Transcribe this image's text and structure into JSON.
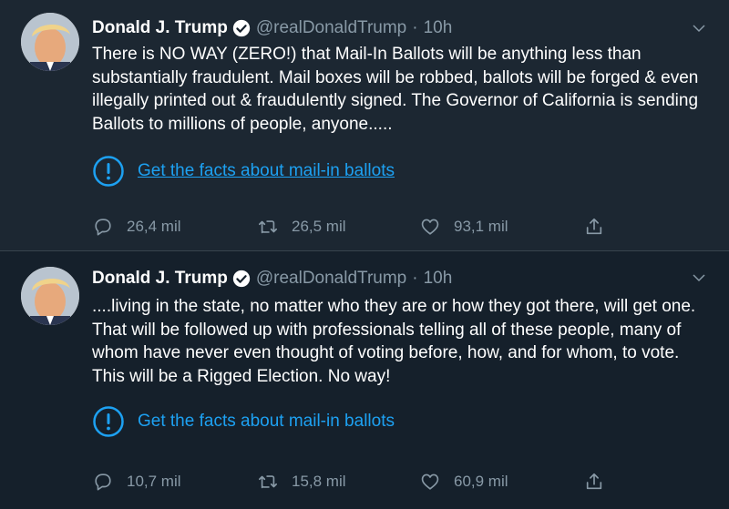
{
  "tweets": [
    {
      "author": "Donald J. Trump",
      "handle": "@realDonaldTrump",
      "separator": "·",
      "time": "10h",
      "text": "There is NO WAY (ZERO!) that Mail-In Ballots will be anything less than substantially fraudulent. Mail boxes will be robbed, ballots will be forged & even illegally printed out & fraudulently signed. The Governor of California is sending Ballots to millions of people, anyone.....",
      "facts_label": "Get the facts about mail-in ballots",
      "replies": "26,4 mil",
      "retweets": "26,5 mil",
      "likes": "93,1 mil"
    },
    {
      "author": "Donald J. Trump",
      "handle": "@realDonaldTrump",
      "separator": "·",
      "time": "10h",
      "text": "....living in the state, no matter who they are or how they got there, will get one. That will be followed up with professionals telling all of these people, many of whom have never even thought of voting before, how, and for whom, to vote. This will be a Rigged Election. No way!",
      "facts_label": "Get the facts about mail-in ballots",
      "replies": "10,7 mil",
      "retweets": "15,8 mil",
      "likes": "60,9 mil"
    }
  ],
  "icons": {
    "verified": "verified-badge-icon",
    "caret": "chevron-down-icon",
    "facts": "exclamation-circle-icon",
    "reply": "reply-icon",
    "retweet": "retweet-icon",
    "like": "heart-icon",
    "share": "share-icon"
  },
  "colors": {
    "background": "#15202b",
    "highlighted_background": "#1c2732",
    "accent": "#1da1f2",
    "secondary_text": "#8899a6",
    "primary_text": "#ffffff"
  }
}
